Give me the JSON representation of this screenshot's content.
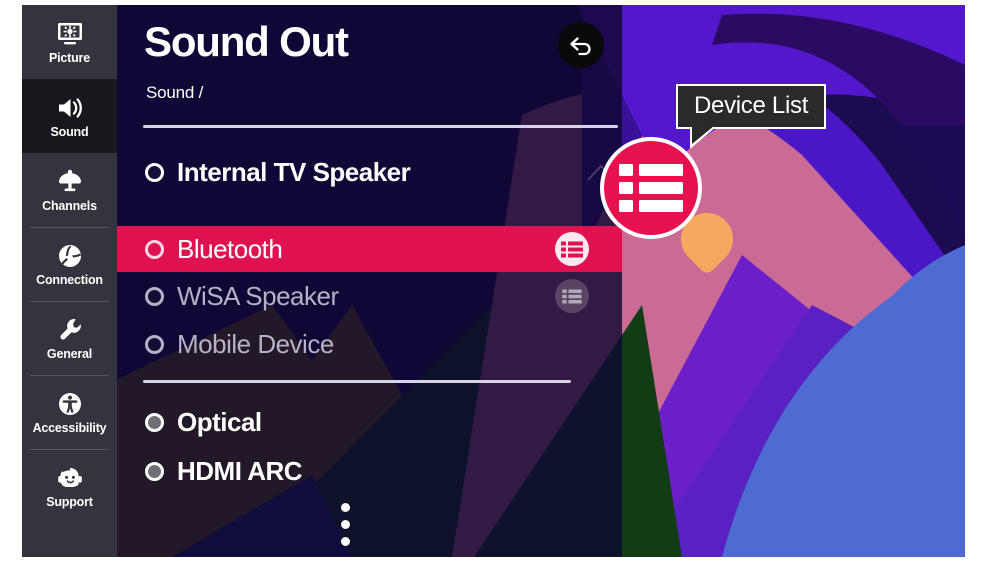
{
  "sidebar": {
    "items": [
      {
        "label": "Picture",
        "icon": "picture-icon",
        "active": false
      },
      {
        "label": "Sound",
        "icon": "speaker-icon",
        "active": true
      },
      {
        "label": "Channels",
        "icon": "satellite-dish-icon",
        "active": false
      },
      {
        "label": "Connection",
        "icon": "network-globe-icon",
        "active": false
      },
      {
        "label": "General",
        "icon": "wrench-icon",
        "active": false
      },
      {
        "label": "Accessibility",
        "icon": "accessibility-icon",
        "active": false
      },
      {
        "label": "Support",
        "icon": "headset-agent-icon",
        "active": false
      }
    ]
  },
  "header": {
    "title": "Sound Out",
    "breadcrumb": "Sound /",
    "back_icon": "back-arrow-icon"
  },
  "options": {
    "group_one": [
      {
        "label": "Internal TV Speaker",
        "state": "normal",
        "selected": false,
        "radio": "radio-unselected",
        "row_icon": null
      },
      {
        "label": "Bluetooth",
        "state": "highlighted",
        "selected": true,
        "radio": "radio-unselected",
        "row_icon": "device-list-icon"
      },
      {
        "label": "WiSA Speaker",
        "state": "disabled",
        "selected": false,
        "radio": "radio-unselected",
        "row_icon": "device-list-icon"
      },
      {
        "label": "Mobile Device",
        "state": "disabled",
        "selected": false,
        "radio": "radio-unselected",
        "row_icon": null
      }
    ],
    "group_two": [
      {
        "label": "Optical",
        "state": "normal",
        "selected": false,
        "radio": "radio-unselected-grey",
        "row_icon": null
      },
      {
        "label": "HDMI ARC",
        "state": "normal",
        "selected": false,
        "radio": "radio-unselected-grey",
        "row_icon": null
      }
    ]
  },
  "scroll_hint": {
    "icon": "more-vertical-dots-icon",
    "dots": 3
  },
  "callout": {
    "tooltip_label": "Device List",
    "magnified_icon": "device-list-icon",
    "cursor_icon": "pointer-blob-icon"
  },
  "colors": {
    "accent_pink": "#e0114f",
    "magnifier_pink": "#e8114f",
    "panel_overlay": "#0e0630",
    "rail_bg": "#34343f",
    "rail_active_bg": "#17171d",
    "tooltip_bg": "#2a2a2a",
    "cursor_orange": "#f6a860",
    "divider": "#d8d4e8",
    "wallpaper_violet": "#4a17c4",
    "wallpaper_navy": "#1b0b4f",
    "wallpaper_pink": "#c96b94",
    "wallpaper_blue": "#4e6bd2",
    "wallpaper_olive": "#7a6205",
    "wallpaper_green": "#123d14"
  }
}
